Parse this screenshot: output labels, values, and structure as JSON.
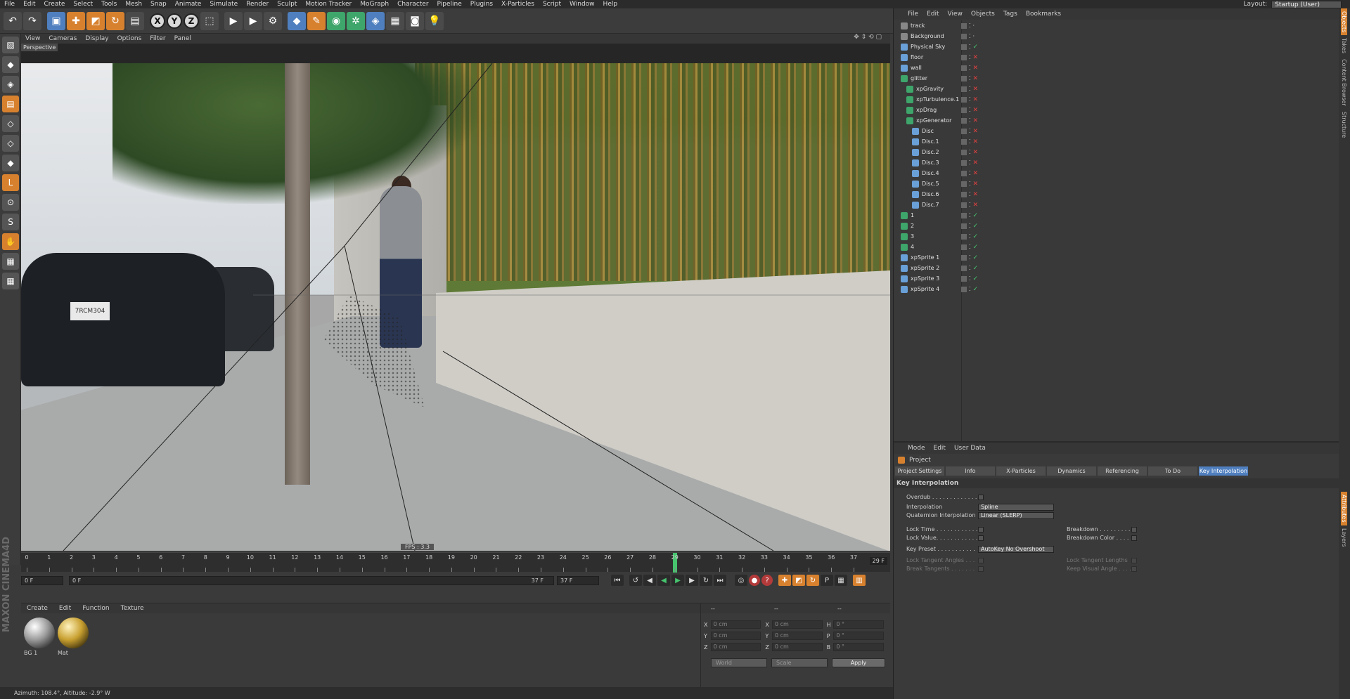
{
  "menubar": [
    "File",
    "Edit",
    "Create",
    "Select",
    "Tools",
    "Mesh",
    "Snap",
    "Animate",
    "Simulate",
    "Render",
    "Sculpt",
    "Motion Tracker",
    "MoGraph",
    "Character",
    "Pipeline",
    "Plugins",
    "X-Particles",
    "Script",
    "Window",
    "Help"
  ],
  "layout": {
    "label": "Layout:",
    "value": "Startup (User)"
  },
  "viewport": {
    "menu": [
      "View",
      "Cameras",
      "Display",
      "Options",
      "Filter",
      "Panel"
    ],
    "camera_label": "Perspective",
    "fps": "FPS : 3.3",
    "plate_text": "7RCM304"
  },
  "timeline": {
    "ticks": [
      "0",
      "1",
      "2",
      "3",
      "4",
      "5",
      "6",
      "7",
      "8",
      "9",
      "10",
      "11",
      "12",
      "13",
      "14",
      "15",
      "16",
      "17",
      "18",
      "19",
      "20",
      "21",
      "22",
      "23",
      "24",
      "25",
      "26",
      "27",
      "28",
      "29",
      "30",
      "31",
      "32",
      "33",
      "34",
      "35",
      "36",
      "37"
    ],
    "current_frame": "29 F",
    "playhead_frame": 29,
    "start_field": "0 F",
    "range_start": "0 F",
    "range_end": "37 F",
    "end_field": "37 F"
  },
  "materials": {
    "menu": [
      "Create",
      "Edit",
      "Function",
      "Texture"
    ],
    "items": [
      {
        "name": "BG 1"
      },
      {
        "name": "Mat"
      }
    ]
  },
  "coords": {
    "headers": [
      "--",
      "--",
      "--"
    ],
    "rows": [
      {
        "a": "X",
        "av": "0 cm",
        "b": "X",
        "bv": "0 cm",
        "c": "H",
        "cv": "0 °"
      },
      {
        "a": "Y",
        "av": "0 cm",
        "b": "Y",
        "bv": "0 cm",
        "c": "P",
        "cv": "0 °"
      },
      {
        "a": "Z",
        "av": "0 cm",
        "b": "Z",
        "bv": "0 cm",
        "c": "B",
        "cv": "0 °"
      }
    ],
    "world": "World",
    "scale": "Scale",
    "apply": "Apply"
  },
  "status": "Azimuth: 108.4°, Altitude: -2.9°  W",
  "objects": {
    "menu": [
      "File",
      "Edit",
      "View",
      "Objects",
      "Tags",
      "Bookmarks"
    ],
    "items": [
      {
        "name": "track",
        "indent": 0,
        "color": "#888",
        "state": "grey"
      },
      {
        "name": "Background",
        "indent": 0,
        "color": "#888",
        "state": "grey"
      },
      {
        "name": "Physical Sky",
        "indent": 0,
        "color": "#6aa0d8",
        "state": "check"
      },
      {
        "name": "floor",
        "indent": 0,
        "color": "#6aa0d8",
        "state": "x"
      },
      {
        "name": "wall",
        "indent": 0,
        "color": "#6aa0d8",
        "state": "x"
      },
      {
        "name": "glitter",
        "indent": 0,
        "color": "#3ea56b",
        "state": "x"
      },
      {
        "name": "xpGravity",
        "indent": 1,
        "color": "#3ea56b",
        "state": "x"
      },
      {
        "name": "xpTurbulence.1",
        "indent": 1,
        "color": "#3ea56b",
        "state": "x"
      },
      {
        "name": "xpDrag",
        "indent": 1,
        "color": "#3ea56b",
        "state": "x"
      },
      {
        "name": "xpGenerator",
        "indent": 1,
        "color": "#3ea56b",
        "state": "x"
      },
      {
        "name": "Disc",
        "indent": 2,
        "color": "#6aa0d8",
        "state": "x"
      },
      {
        "name": "Disc.1",
        "indent": 2,
        "color": "#6aa0d8",
        "state": "x"
      },
      {
        "name": "Disc.2",
        "indent": 2,
        "color": "#6aa0d8",
        "state": "x"
      },
      {
        "name": "Disc.3",
        "indent": 2,
        "color": "#6aa0d8",
        "state": "x"
      },
      {
        "name": "Disc.4",
        "indent": 2,
        "color": "#6aa0d8",
        "state": "x"
      },
      {
        "name": "Disc.5",
        "indent": 2,
        "color": "#6aa0d8",
        "state": "x"
      },
      {
        "name": "Disc.6",
        "indent": 2,
        "color": "#6aa0d8",
        "state": "x"
      },
      {
        "name": "Disc.7",
        "indent": 2,
        "color": "#6aa0d8",
        "state": "x"
      },
      {
        "name": "1",
        "indent": 0,
        "color": "#3ea56b",
        "state": "check"
      },
      {
        "name": "2",
        "indent": 0,
        "color": "#3ea56b",
        "state": "check"
      },
      {
        "name": "3",
        "indent": 0,
        "color": "#3ea56b",
        "state": "check"
      },
      {
        "name": "4",
        "indent": 0,
        "color": "#3ea56b",
        "state": "check"
      },
      {
        "name": "xpSprite 1",
        "indent": 0,
        "color": "#6aa0d8",
        "state": "check"
      },
      {
        "name": "xpSprite 2",
        "indent": 0,
        "color": "#6aa0d8",
        "state": "check"
      },
      {
        "name": "xpSprite 3",
        "indent": 0,
        "color": "#6aa0d8",
        "state": "check"
      },
      {
        "name": "xpSprite 4",
        "indent": 0,
        "color": "#6aa0d8",
        "state": "check"
      }
    ]
  },
  "attributes": {
    "menu": [
      "Mode",
      "Edit",
      "User Data"
    ],
    "title": "Project",
    "tabs": [
      "Project Settings",
      "Info",
      "X-Particles",
      "Dynamics",
      "Referencing",
      "To Do",
      "Key Interpolation"
    ],
    "active_tab": "Key Interpolation",
    "section": "Key Interpolation",
    "overdub": "Overdub . . . . . . . . . . . . .",
    "interpolation_label": "Interpolation",
    "interpolation_value": "Spline",
    "quat_label": "Quaternion Interpolation",
    "quat_value": "Linear (SLERP)",
    "lock_time": "Lock Time . . . . . . . . . . . .",
    "lock_value": "Lock Value. . . . . . . . . . . .",
    "breakdown": "Breakdown . . . . . . . . .",
    "breakdown_color": "Breakdown Color . . . . .",
    "key_preset_label": "Key Preset . . . . . . . . . . .",
    "key_preset_value": "AutoKey No Overshoot",
    "lock_tangent_angles": "Lock Tangent Angles . . .",
    "break_tangents": "Break Tangents . . . . . . .",
    "lock_tangent_lengths": "Lock Tangent Lengths",
    "keep_visual_angle": "Keep Visual Angle . . . ."
  },
  "sidetabs": [
    "Objects",
    "Takes",
    "Content Browser",
    "Structure"
  ],
  "sidetabs2": [
    "Attributes",
    "Layers"
  ],
  "colors": {
    "accent": "#4f7fbf",
    "orange": "#d7812f",
    "green": "#46c46e"
  }
}
